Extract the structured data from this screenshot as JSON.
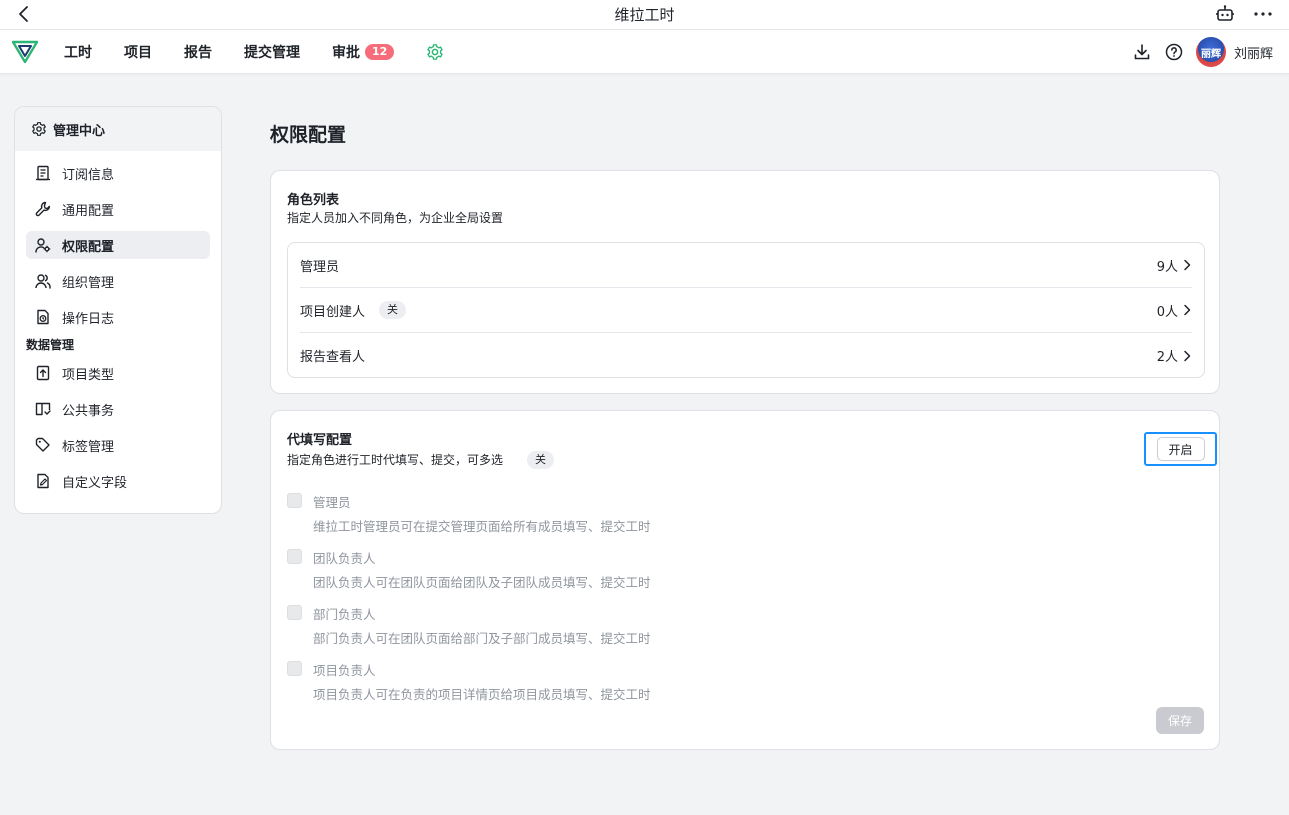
{
  "window": {
    "title": "维拉工时"
  },
  "nav": {
    "items": [
      {
        "label": "工时"
      },
      {
        "label": "项目"
      },
      {
        "label": "报告"
      },
      {
        "label": "提交管理"
      },
      {
        "label": "审批",
        "badge": "12"
      }
    ],
    "user": {
      "avatar_text": "丽辉",
      "name": "刘丽辉"
    }
  },
  "sidebar": {
    "header": "管理中心",
    "items": [
      {
        "label": "订阅信息",
        "icon": "receipt-icon"
      },
      {
        "label": "通用配置",
        "icon": "wrench-icon"
      },
      {
        "label": "权限配置",
        "icon": "user-settings-icon",
        "active": true
      },
      {
        "label": "组织管理",
        "icon": "users-icon"
      }
    ],
    "item_log": {
      "label": "操作日志",
      "icon": "log-icon"
    },
    "group_label": "数据管理",
    "data_items": [
      {
        "label": "项目类型",
        "icon": "upload-doc-icon"
      },
      {
        "label": "公共事务",
        "icon": "book-icon"
      },
      {
        "label": "标签管理",
        "icon": "tag-icon"
      },
      {
        "label": "自定义字段",
        "icon": "edit-doc-icon"
      }
    ]
  },
  "main": {
    "title": "权限配置",
    "roles_card": {
      "title": "角色列表",
      "desc": "指定人员加入不同角色，为企业全局设置",
      "rows": [
        {
          "name": "管理员",
          "count": "9人",
          "tag": ""
        },
        {
          "name": "项目创建人",
          "count": "0人",
          "tag": "关"
        },
        {
          "name": "报告查看人",
          "count": "2人",
          "tag": ""
        }
      ]
    },
    "proxy_card": {
      "title": "代填写配置",
      "desc": "指定角色进行工时代填写、提交，可多选",
      "status_tag": "关",
      "toggle_label": "开启",
      "options": [
        {
          "label": "管理员",
          "desc": "维拉工时管理员可在提交管理页面给所有成员填写、提交工时"
        },
        {
          "label": "团队负责人",
          "desc": "团队负责人可在团队页面给团队及子团队成员填写、提交工时"
        },
        {
          "label": "部门负责人",
          "desc": "部门负责人可在团队页面给部门及子部门成员填写、提交工时"
        },
        {
          "label": "项目负责人",
          "desc": "项目负责人可在负责的项目详情页给项目成员填写、提交工时"
        }
      ],
      "save_label": "保存"
    }
  }
}
